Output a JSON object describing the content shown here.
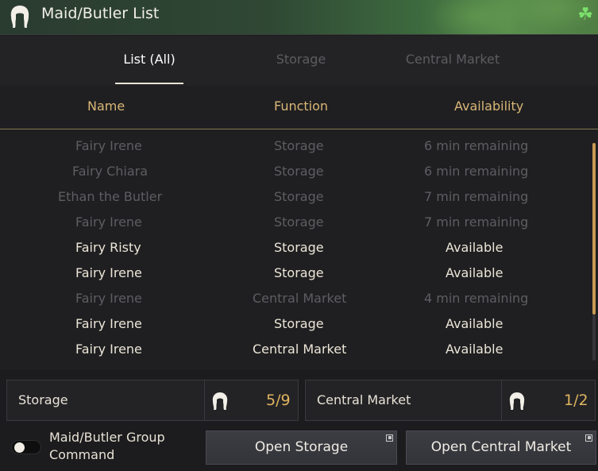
{
  "window": {
    "title": "Maid/Butler List",
    "icon": "maid-head-icon",
    "corner_icon": "clover-icon"
  },
  "tabs": [
    {
      "label": "List (All)",
      "active": true
    },
    {
      "label": "Storage",
      "active": false
    },
    {
      "label": "Central Market",
      "active": false
    }
  ],
  "columns": {
    "name": "Name",
    "function": "Function",
    "availability": "Availability"
  },
  "rows": [
    {
      "name": "Fairy Irene",
      "function": "Storage",
      "availability": "6 min remaining",
      "available": false
    },
    {
      "name": "Fairy Chiara",
      "function": "Storage",
      "availability": "6 min remaining",
      "available": false
    },
    {
      "name": "Ethan the Butler",
      "function": "Storage",
      "availability": "7 min remaining",
      "available": false
    },
    {
      "name": "Fairy Irene",
      "function": "Storage",
      "availability": "7 min remaining",
      "available": false
    },
    {
      "name": "Fairy Risty",
      "function": "Storage",
      "availability": "Available",
      "available": true
    },
    {
      "name": "Fairy Irene",
      "function": "Storage",
      "availability": "Available",
      "available": true
    },
    {
      "name": "Fairy Irene",
      "function": "Central Market",
      "availability": "4 min remaining",
      "available": false
    },
    {
      "name": "Fairy Irene",
      "function": "Storage",
      "availability": "Available",
      "available": true
    },
    {
      "name": "Fairy Irene",
      "function": "Central Market",
      "availability": "Available",
      "available": true
    }
  ],
  "summary": {
    "storage": {
      "label": "Storage",
      "count": "5/9",
      "icon": "maid-head-icon"
    },
    "market": {
      "label": "Central Market",
      "count": "1/2",
      "icon": "maid-head-icon"
    }
  },
  "footer": {
    "group_command_label_1": "Maid/Butler Group",
    "group_command_label_2": "Command",
    "toggle_on": false,
    "open_storage": "Open Storage",
    "open_market": "Open Central Market"
  },
  "colors": {
    "accent": "#d9b677",
    "value": "#e0b45f",
    "dim_text": "#5e5e62",
    "bright_text": "#ece6d8"
  }
}
